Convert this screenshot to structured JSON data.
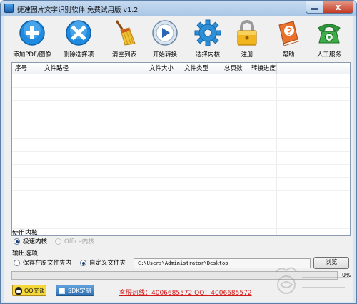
{
  "window": {
    "title": "捷速图片文字识别软件 免费试用版 v1.2",
    "close_glyph": "x"
  },
  "toolbar": {
    "items": [
      {
        "label": "添加PDF/图像",
        "icon": "add-icon"
      },
      {
        "label": "删除选择项",
        "icon": "delete-icon"
      },
      {
        "label": "清空列表",
        "icon": "broom-icon"
      },
      {
        "label": "开始转换",
        "icon": "play-icon"
      },
      {
        "label": "选择内核",
        "icon": "gear-icon"
      },
      {
        "label": "注册",
        "icon": "lock-icon"
      },
      {
        "label": "帮助",
        "icon": "help-book-icon"
      },
      {
        "label": "人工服务",
        "icon": "phone-icon"
      }
    ]
  },
  "file_list": {
    "columns": [
      "序号",
      "文件路径",
      "文件大小",
      "文件类型",
      "总页数",
      "转换进度"
    ],
    "rows": []
  },
  "engine": {
    "group_label": "使用内核",
    "options": [
      {
        "label": "极速内核",
        "selected": true,
        "enabled": true
      },
      {
        "label": "Office内核",
        "selected": false,
        "enabled": false
      }
    ]
  },
  "output": {
    "group_label": "输出选项",
    "options": [
      {
        "label": "保存在原文件夹内",
        "selected": false
      },
      {
        "label": "自定义文件夹",
        "selected": true
      }
    ],
    "path_value": "C:\\Users\\Administrator\\Desktop",
    "browse_label": "浏览"
  },
  "progress": {
    "value": 0,
    "label": "0%"
  },
  "footer": {
    "qq_label": "QQ交谈",
    "sdk_label": "SDK定制",
    "hotline": "客服热线：4006685572 QQ：4006685572"
  },
  "colors": {
    "title_bar": "#a9c6e6",
    "hotline_red": "#d21a1a",
    "progress_green": "#3aa83a",
    "qq_yellow": "#f5d83a",
    "sdk_blue": "#2e70b4"
  }
}
